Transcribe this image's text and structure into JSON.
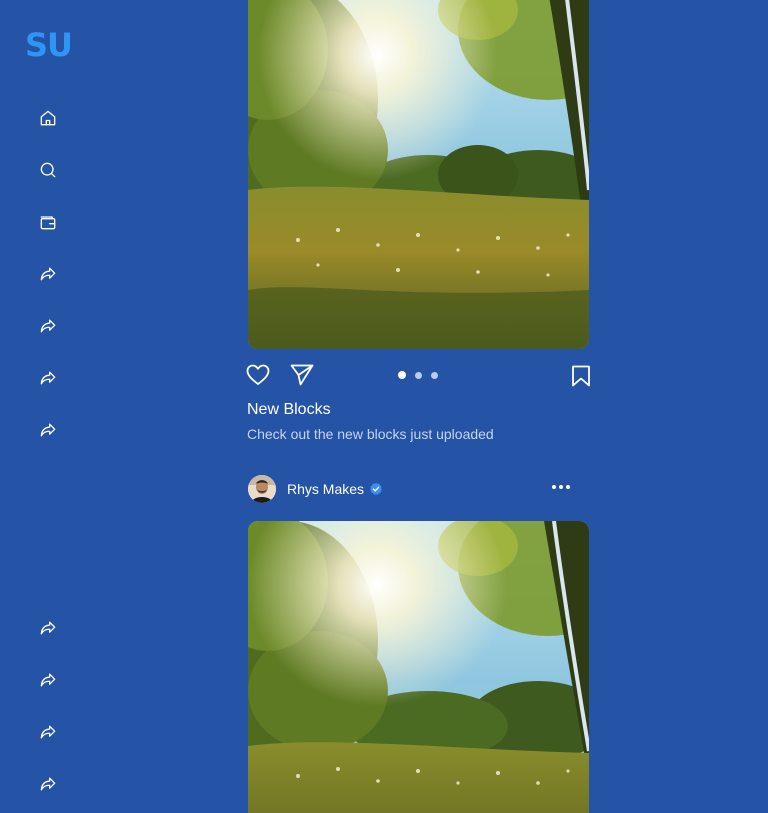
{
  "brand": {
    "logo_text": "SU",
    "logo_color": "#2f95f4"
  },
  "sidebar": {
    "top_items": [
      {
        "icon": "home-icon"
      },
      {
        "icon": "search-icon"
      },
      {
        "icon": "wallet-icon"
      },
      {
        "icon": "share-icon"
      },
      {
        "icon": "share-icon"
      },
      {
        "icon": "share-icon"
      },
      {
        "icon": "share-icon"
      }
    ],
    "bottom_items": [
      {
        "icon": "share-icon"
      },
      {
        "icon": "share-icon"
      },
      {
        "icon": "share-icon"
      },
      {
        "icon": "share-icon"
      }
    ]
  },
  "posts": [
    {
      "image": "meadow-sunlight-image",
      "actions": {
        "like_icon": "heart-icon",
        "send_icon": "send-icon",
        "save_icon": "bookmark-icon"
      },
      "carousel": {
        "count": 3,
        "active_index": 0
      },
      "title": "New Blocks",
      "caption": "Check out the new blocks just uploaded"
    },
    {
      "author": {
        "name": "Rhys Makes",
        "verified": true
      },
      "more_icon": "more-horizontal-icon",
      "image": "meadow-sunlight-image"
    }
  ],
  "colors": {
    "background": "#2553a5",
    "accent": "#2f95f4",
    "text_primary": "#ffffff",
    "text_secondary": "#c5d5ef",
    "verified_badge": "#3b8cf5"
  }
}
